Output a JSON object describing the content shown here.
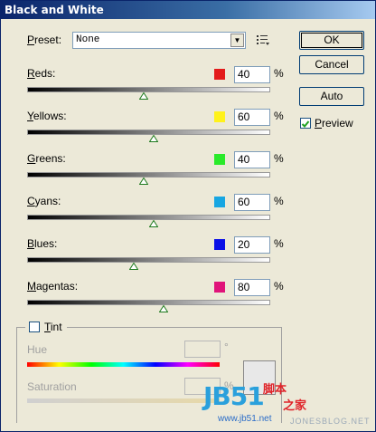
{
  "window": {
    "title": "Black and White"
  },
  "preset": {
    "label": "Preset:",
    "value": "None"
  },
  "buttons": {
    "ok": "OK",
    "cancel": "Cancel",
    "auto": "Auto"
  },
  "preview": {
    "label": "Preview",
    "checked": true
  },
  "percent_symbol": "%",
  "sliders": [
    {
      "label": "Reds:",
      "value": "40",
      "color": "#E31B1B",
      "fraction": 0.48
    },
    {
      "label": "Yellows:",
      "value": "60",
      "color": "#FFF21B",
      "fraction": 0.52
    },
    {
      "label": "Greens:",
      "value": "40",
      "color": "#2AEA2A",
      "fraction": 0.48
    },
    {
      "label": "Cyans:",
      "value": "60",
      "color": "#17A6E2",
      "fraction": 0.52
    },
    {
      "label": "Blues:",
      "value": "20",
      "color": "#0A10E6",
      "fraction": 0.44
    },
    {
      "label": "Magentas:",
      "value": "80",
      "color": "#E0137A",
      "fraction": 0.56
    }
  ],
  "tint": {
    "label": "Tint",
    "checked": false,
    "hue_label": "Hue",
    "hue_unit": "°",
    "saturation_label": "Saturation",
    "saturation_unit": "%"
  },
  "watermark": {
    "logo": "JB51",
    "cn1": "脚本",
    "cn2": "之家",
    "url": "www.jb51.net",
    "url2": "JONESBLOG.NET"
  }
}
